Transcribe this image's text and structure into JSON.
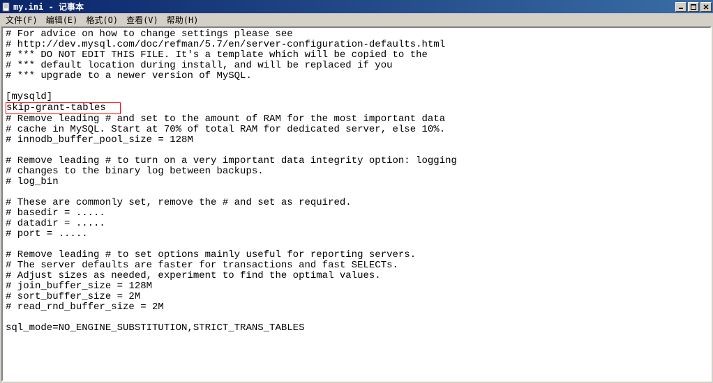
{
  "titlebar": {
    "title": "my.ini - 记事本"
  },
  "menubar": {
    "file": "文件(F)",
    "edit": "编辑(E)",
    "format": "格式(O)",
    "view": "查看(V)",
    "help": "帮助(H)"
  },
  "content": {
    "lines": [
      "# For advice on how to change settings please see",
      "# http://dev.mysql.com/doc/refman/5.7/en/server-configuration-defaults.html",
      "# *** DO NOT EDIT THIS FILE. It's a template which will be copied to the",
      "# *** default location during install, and will be replaced if you",
      "# *** upgrade to a newer version of MySQL.",
      "",
      "[mysqld]"
    ],
    "highlighted_line": "skip-grant-tables",
    "lines_after": [
      "# Remove leading # and set to the amount of RAM for the most important data",
      "# cache in MySQL. Start at 70% of total RAM for dedicated server, else 10%.",
      "# innodb_buffer_pool_size = 128M",
      "",
      "# Remove leading # to turn on a very important data integrity option: logging",
      "# changes to the binary log between backups.",
      "# log_bin",
      "",
      "# These are commonly set, remove the # and set as required.",
      "# basedir = .....",
      "# datadir = .....",
      "# port = .....",
      "",
      "# Remove leading # to set options mainly useful for reporting servers.",
      "# The server defaults are faster for transactions and fast SELECTs.",
      "# Adjust sizes as needed, experiment to find the optimal values.",
      "# join_buffer_size = 128M",
      "# sort_buffer_size = 2M",
      "# read_rnd_buffer_size = 2M",
      "",
      "sql_mode=NO_ENGINE_SUBSTITUTION,STRICT_TRANS_TABLES"
    ]
  }
}
